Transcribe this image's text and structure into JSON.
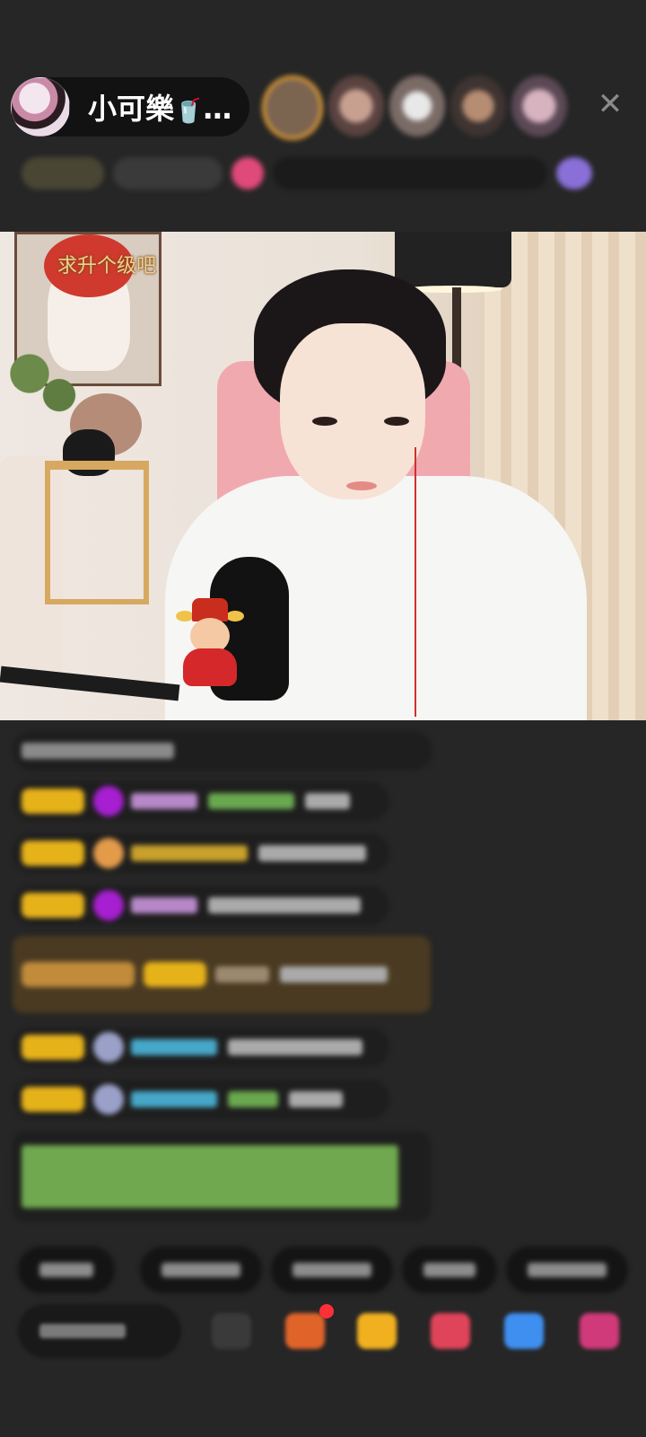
{
  "header": {
    "host_name": "小可樂",
    "host_name_suffix": "…",
    "cup_icon": "🥤",
    "close_glyph": "✕",
    "viewers": [
      "viewer-1",
      "viewer-2",
      "viewer-3",
      "viewer-4",
      "viewer-5"
    ]
  },
  "video": {
    "overlay_text": "求升个级吧"
  },
  "icons": {
    "host_avatar": "avatar",
    "close": "close-icon",
    "mascot": "fortune-god-sticker",
    "gift": "gift-icon",
    "chat": "chat-bubble-icon"
  },
  "colors": {
    "background": "#262626",
    "level_badge": "#e6b21a",
    "highlight_message": "#4a3a22",
    "overlay_text": "#f2d08b"
  }
}
